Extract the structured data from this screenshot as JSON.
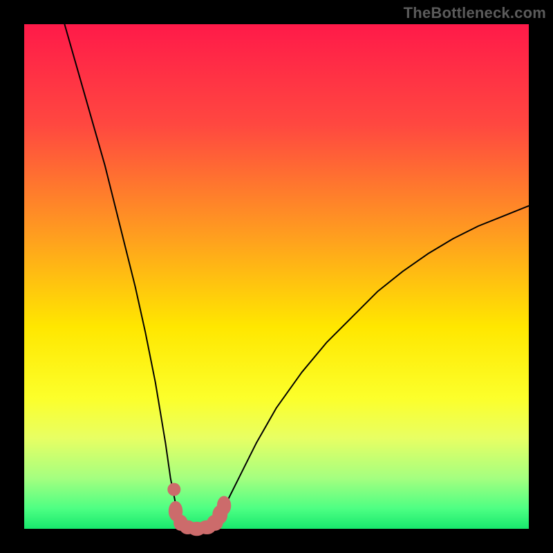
{
  "watermark": "TheBottleneck.com",
  "chart_data": {
    "type": "line",
    "title": "",
    "xlabel": "",
    "ylabel": "",
    "xlim": [
      0,
      100
    ],
    "ylim": [
      0,
      100
    ],
    "grid": false,
    "legend": false,
    "gradient_stops": [
      {
        "pct": 0,
        "color": "#ff1a49"
      },
      {
        "pct": 20,
        "color": "#ff4840"
      },
      {
        "pct": 42,
        "color": "#ff9e1f"
      },
      {
        "pct": 60,
        "color": "#ffe700"
      },
      {
        "pct": 74,
        "color": "#fcff2a"
      },
      {
        "pct": 82,
        "color": "#e8ff63"
      },
      {
        "pct": 90,
        "color": "#a4ff80"
      },
      {
        "pct": 96,
        "color": "#4dff83"
      },
      {
        "pct": 100,
        "color": "#18e86d"
      }
    ],
    "series": [
      {
        "name": "bottleneck-curve",
        "stroke": "#000000",
        "stroke_width": 2,
        "x": [
          8,
          10,
          12,
          14,
          16,
          18,
          20,
          22,
          24,
          26,
          27,
          28,
          29,
          30,
          31,
          32,
          33,
          34,
          35,
          36,
          37,
          38,
          39,
          40,
          42,
          44,
          46,
          50,
          55,
          60,
          65,
          70,
          75,
          80,
          85,
          90,
          95,
          100
        ],
        "y": [
          100,
          93,
          86,
          79,
          72,
          64,
          56,
          48,
          39,
          29,
          23,
          17,
          10,
          5,
          2,
          0.5,
          0,
          0,
          0,
          0,
          0.5,
          1.5,
          3,
          5,
          9,
          13,
          17,
          24,
          31,
          37,
          42,
          47,
          51,
          54.5,
          57.5,
          60,
          62,
          64
        ]
      }
    ],
    "markers": [
      {
        "shape": "dot",
        "cx": 29.7,
        "cy": 7.8,
        "r": 1.3,
        "fill": "#cc6b6b"
      },
      {
        "shape": "round",
        "cx": 30.0,
        "cy": 3.5,
        "rx": 1.4,
        "ry": 2.0,
        "fill": "#cc6b6b"
      },
      {
        "shape": "round",
        "cx": 31.0,
        "cy": 1.2,
        "rx": 1.4,
        "ry": 1.6,
        "fill": "#cc6b6b"
      },
      {
        "shape": "round",
        "cx": 32.4,
        "cy": 0.3,
        "rx": 1.6,
        "ry": 1.4,
        "fill": "#cc6b6b"
      },
      {
        "shape": "round",
        "cx": 34.2,
        "cy": 0.0,
        "rx": 1.8,
        "ry": 1.4,
        "fill": "#cc6b6b"
      },
      {
        "shape": "round",
        "cx": 36.2,
        "cy": 0.3,
        "rx": 1.8,
        "ry": 1.4,
        "fill": "#cc6b6b"
      },
      {
        "shape": "round",
        "cx": 37.8,
        "cy": 1.2,
        "rx": 1.6,
        "ry": 1.6,
        "fill": "#cc6b6b"
      },
      {
        "shape": "round",
        "cx": 38.8,
        "cy": 2.8,
        "rx": 1.5,
        "ry": 1.9,
        "fill": "#cc6b6b"
      },
      {
        "shape": "round",
        "cx": 39.6,
        "cy": 4.6,
        "rx": 1.4,
        "ry": 1.9,
        "fill": "#cc6b6b"
      }
    ]
  }
}
